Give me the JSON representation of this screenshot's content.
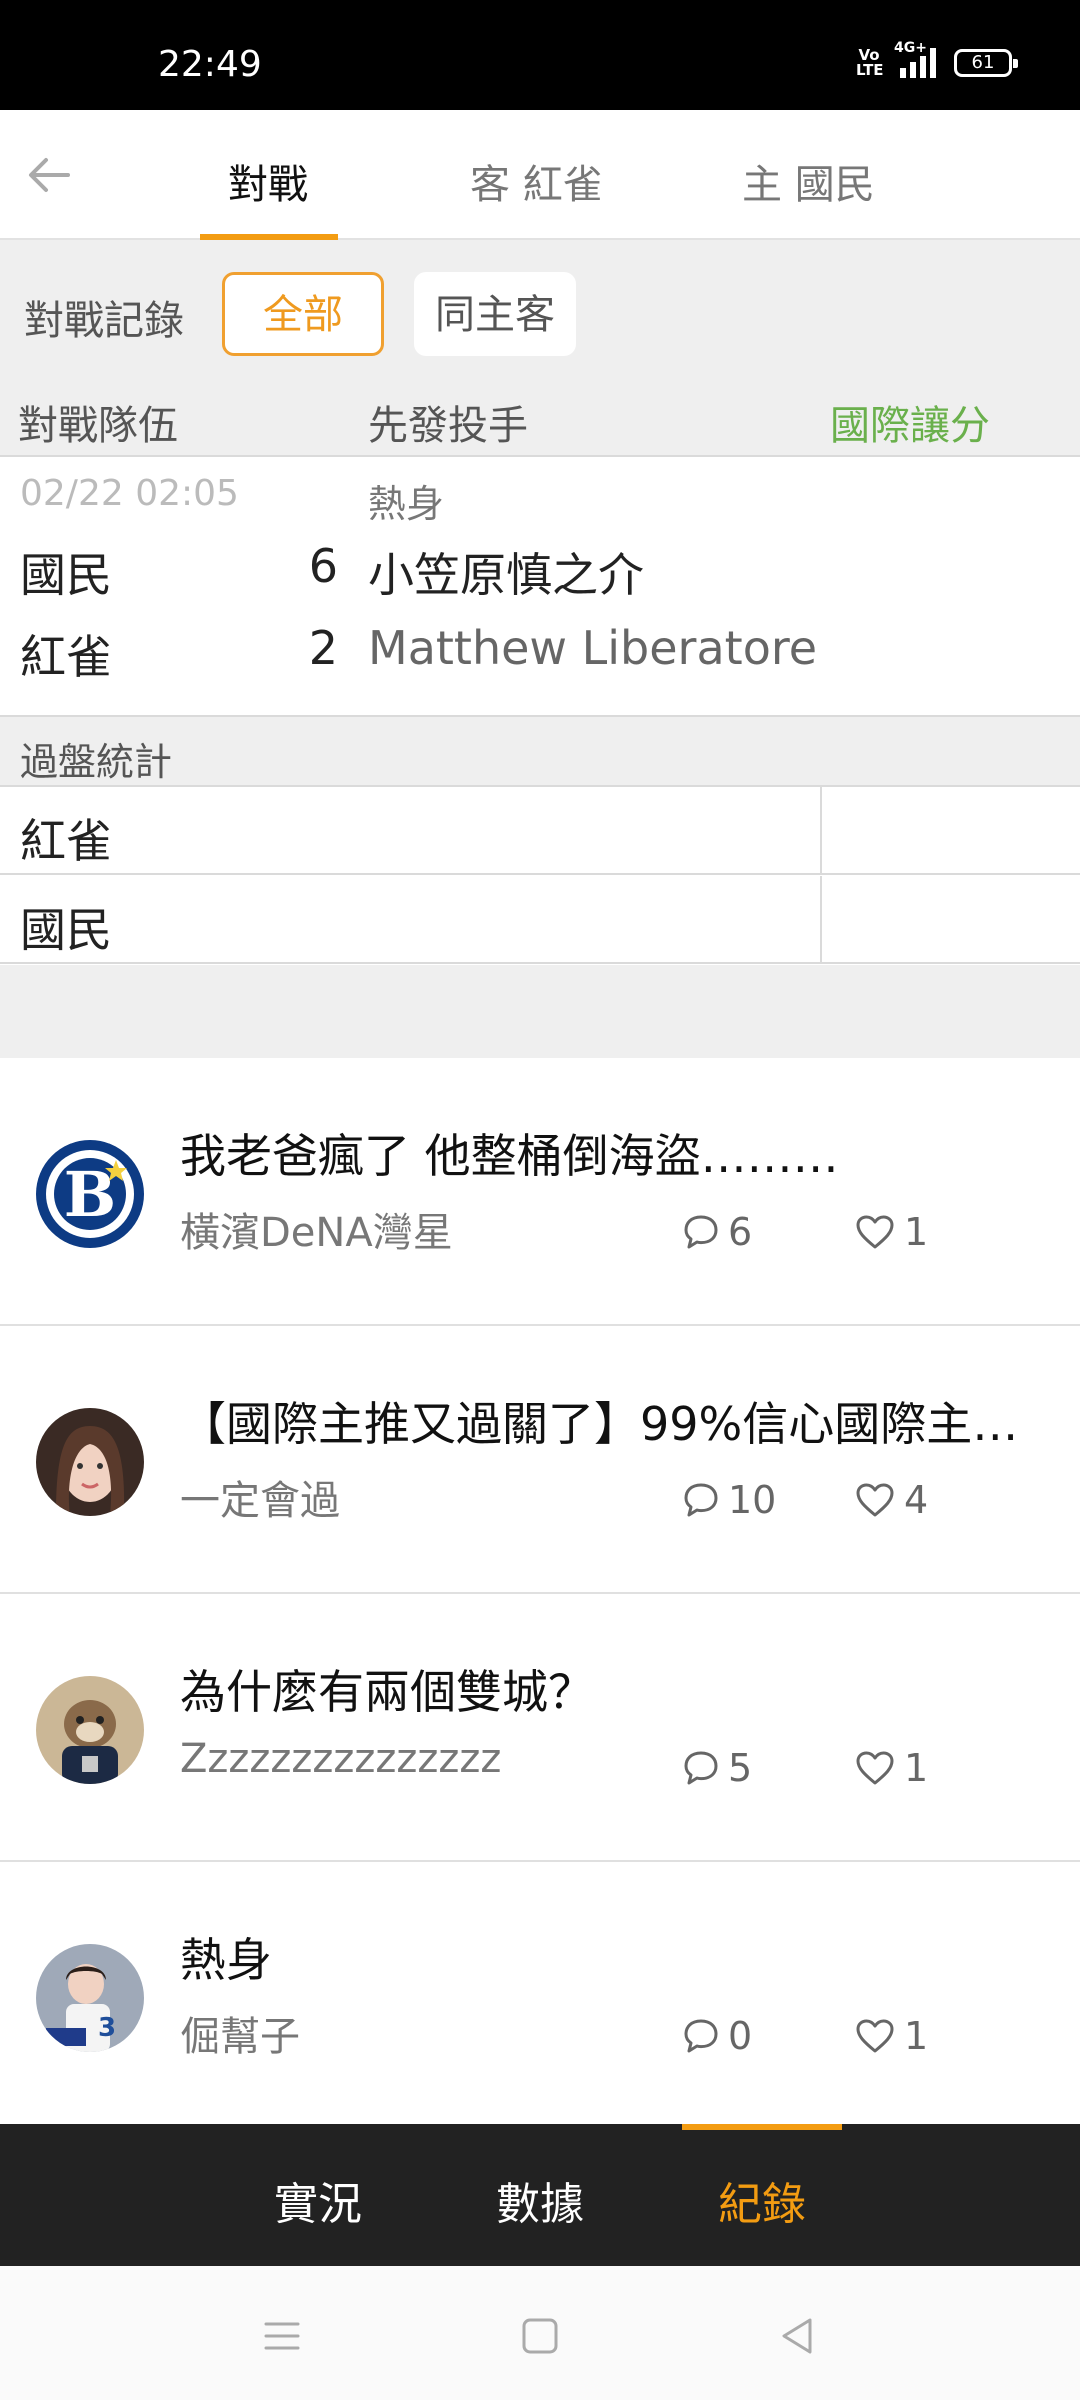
{
  "status_bar": {
    "time": "22:49",
    "volte": "Vo\nLTE",
    "network": "4G+",
    "battery": "61"
  },
  "nav": {
    "tabs": [
      {
        "label": "對戰",
        "active": true
      },
      {
        "label": "客 紅雀",
        "active": false
      },
      {
        "label": "主 國民",
        "active": false
      }
    ]
  },
  "filter": {
    "label": "對戰記錄",
    "options": [
      "全部",
      "同主客"
    ],
    "selected": "全部"
  },
  "table_header": {
    "teams": "對戰隊伍",
    "pitcher": "先發投手",
    "handicap": "國際讓分"
  },
  "match": {
    "date": "02/22 02:05",
    "status": "熱身",
    "home": {
      "team": "國民",
      "score": "6",
      "pitcher": "小笠原慎之介"
    },
    "away": {
      "team": "紅雀",
      "score": "2",
      "pitcher": "Matthew Liberatore"
    }
  },
  "stats": {
    "label": "過盤統計",
    "rows": [
      "紅雀",
      "國民"
    ]
  },
  "posts": [
    {
      "title": "我老爸瘋了 他整桶倒海盜………",
      "author": "橫濱DeNA灣星",
      "comments": "6",
      "likes": "1"
    },
    {
      "title": "【國際主推又過關了】99%信心國際主…",
      "author": "一定會過",
      "comments": "10",
      "likes": "4"
    },
    {
      "title": "為什麼有兩個雙城？",
      "author": "Zzzzzzzzzzzzzzz",
      "comments": "5",
      "likes": "1"
    },
    {
      "title": "熱身",
      "author": "倔幫子",
      "comments": "0",
      "likes": "1"
    }
  ],
  "bottom_tabs": [
    {
      "label": "實況",
      "active": false
    },
    {
      "label": "數據",
      "active": false
    },
    {
      "label": "紀錄",
      "active": true
    }
  ],
  "colors": {
    "accent": "#f39c12",
    "handicap_green": "#6ab04c",
    "tab_bar_bg": "#222222"
  }
}
